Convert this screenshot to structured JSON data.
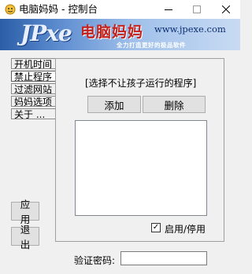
{
  "window": {
    "title": "电脑妈妈 - 控制台",
    "min_icon": "minimize-icon",
    "max_icon": "maximize-icon",
    "close_icon": "close-icon"
  },
  "banner": {
    "logo": "JPxe",
    "brand": "电脑妈妈",
    "website": "www.jpexe.com",
    "slogan": "全力打造更好的极品软件"
  },
  "nav": [
    {
      "label": "开机时间",
      "active": false
    },
    {
      "label": "禁止程序",
      "active": true
    },
    {
      "label": "过滤网站",
      "active": false
    },
    {
      "label": "妈妈选项",
      "active": false
    },
    {
      "label": "关于 ...",
      "active": false
    }
  ],
  "panel": {
    "hint": "[选择不让孩子运行的程序]",
    "add_label": "添加",
    "delete_label": "删除",
    "program_list": [],
    "enable_label": "启用/停用",
    "enable_checked": true
  },
  "actions": {
    "apply_label": "应用",
    "exit_label": "退出"
  },
  "password": {
    "label": "验证密码:",
    "value": ""
  },
  "colors": {
    "banner_start": "#2b5ea8",
    "banner_end": "#c9dbf3",
    "brand_red": "#c4221c"
  }
}
